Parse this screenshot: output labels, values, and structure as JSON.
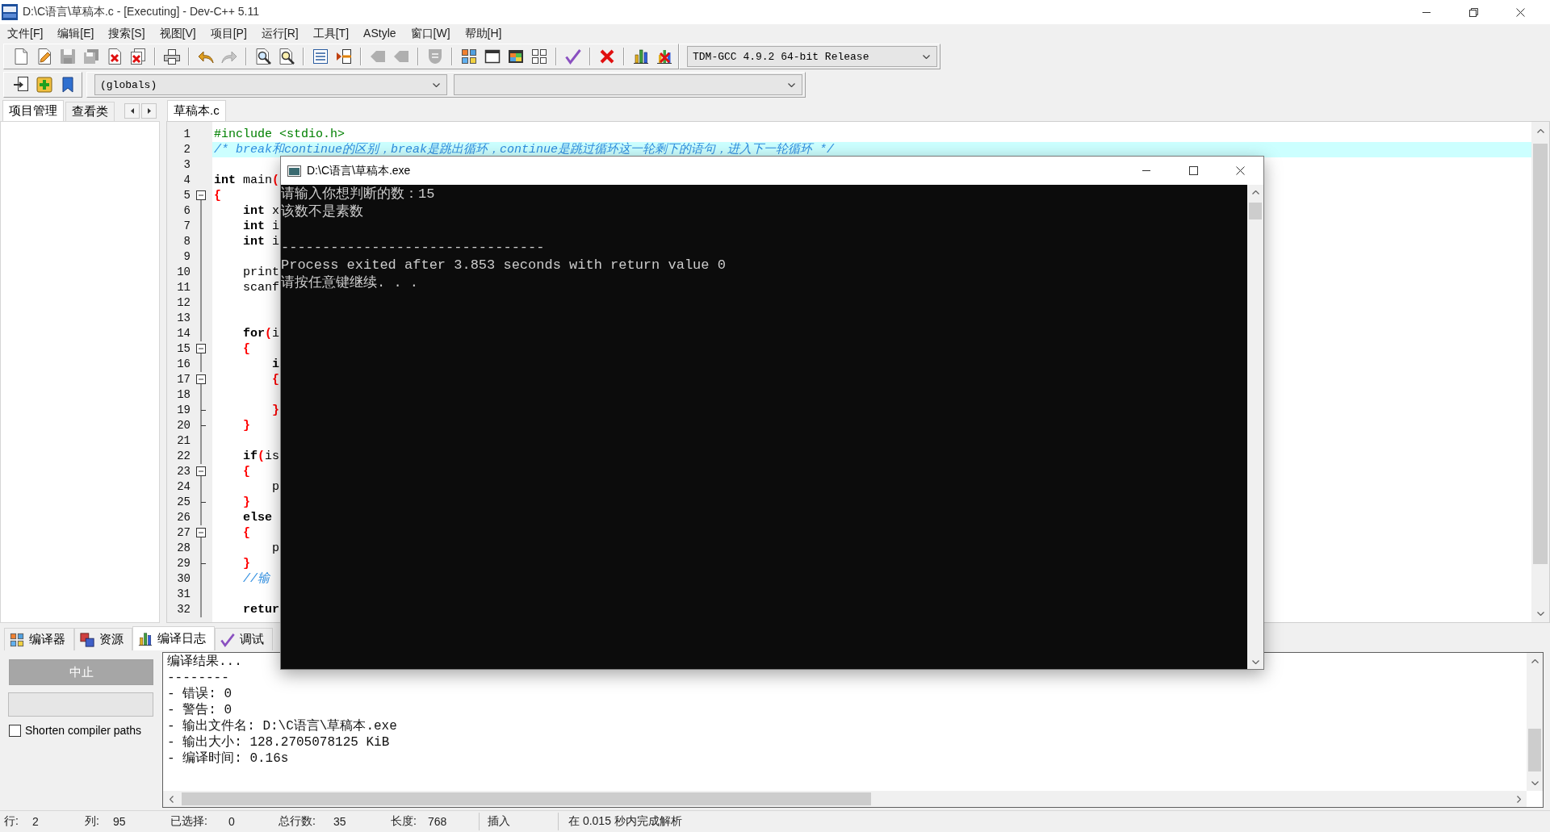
{
  "window": {
    "title": "D:\\C语言\\草稿本.c - [Executing] - Dev-C++ 5.11"
  },
  "menu": [
    "文件[F]",
    "编辑[E]",
    "搜索[S]",
    "视图[V]",
    "项目[P]",
    "运行[R]",
    "工具[T]",
    "AStyle",
    "窗口[W]",
    "帮助[H]"
  ],
  "main_toolbar": {
    "groups": [
      [
        {
          "kind": "new",
          "disabled": false
        },
        {
          "kind": "open",
          "disabled": false
        },
        {
          "kind": "save",
          "disabled": true
        },
        {
          "kind": "save_all",
          "disabled": true
        },
        {
          "kind": "close",
          "disabled": false
        },
        {
          "kind": "close_all",
          "disabled": false
        }
      ],
      [
        {
          "kind": "print",
          "disabled": false
        }
      ],
      [
        {
          "kind": "undo",
          "disabled": false
        },
        {
          "kind": "redo",
          "disabled": true
        }
      ],
      [
        {
          "kind": "find",
          "disabled": false
        },
        {
          "kind": "replace",
          "disabled": false
        }
      ],
      [
        {
          "kind": "goto",
          "disabled": false
        },
        {
          "kind": "indent",
          "disabled": false
        }
      ],
      [
        {
          "kind": "prev",
          "disabled": true
        },
        {
          "kind": "next",
          "disabled": true
        }
      ],
      [
        {
          "kind": "bookmark",
          "disabled": true
        }
      ],
      [
        {
          "kind": "compile",
          "disabled": false
        },
        {
          "kind": "run",
          "disabled": false
        },
        {
          "kind": "compile_run",
          "disabled": false
        },
        {
          "kind": "rebuild",
          "disabled": false
        }
      ],
      [
        {
          "kind": "check",
          "disabled": false
        }
      ],
      [
        {
          "kind": "abort",
          "disabled": false
        }
      ],
      [
        {
          "kind": "profile",
          "disabled": false
        },
        {
          "kind": "delete_profile",
          "disabled": false
        }
      ]
    ],
    "compiler": "TDM-GCC 4.9.2 64-bit Release"
  },
  "class_toolbar": {
    "buttons": [
      {
        "kind": "insert"
      },
      {
        "kind": "add"
      },
      {
        "kind": "mark"
      }
    ],
    "scope": "(globals)"
  },
  "side_panel": {
    "tabs": [
      {
        "label": "项目管理",
        "selected": true
      },
      {
        "label": "查看类",
        "selected": false
      }
    ]
  },
  "editor": {
    "tabs": [
      {
        "label": "草稿本.c",
        "selected": true
      }
    ],
    "lines": [
      {
        "number": "1",
        "kind": "plain",
        "highlighted": false,
        "tokens": [
          {
            "text": "#include <stdio.h>",
            "kind": "preprocessor"
          }
        ]
      },
      {
        "number": "2",
        "kind": "plain",
        "highlighted": true,
        "tokens": [
          {
            "text": "/* break和continue的区别，break是跳出循环，continue是跳过循环这一轮剩下的语句，进入下一轮循环 */",
            "kind": "comment"
          }
        ]
      },
      {
        "number": "3",
        "kind": "plain",
        "highlighted": false
      },
      {
        "number": "4",
        "kind": "plain",
        "highlighted": false,
        "tokens": [
          {
            "text": "int",
            "kind": "keyword"
          },
          {
            "text": " main",
            "kind": "plain"
          },
          {
            "text": "(",
            "kind": "symbol"
          }
        ]
      },
      {
        "number": "5",
        "kind": "opener",
        "highlighted": false,
        "tokens": [
          {
            "text": "{",
            "kind": "symbol"
          }
        ]
      },
      {
        "number": "6",
        "kind": "inner",
        "highlighted": false,
        "tokens": [
          {
            "text": "    int",
            "kind": "keyword"
          },
          {
            "text": " x",
            "kind": "plain"
          }
        ]
      },
      {
        "number": "7",
        "kind": "inner",
        "highlighted": false,
        "tokens": [
          {
            "text": "    int",
            "kind": "keyword"
          },
          {
            "text": " i",
            "kind": "plain"
          }
        ]
      },
      {
        "number": "8",
        "kind": "inner",
        "highlighted": false,
        "tokens": [
          {
            "text": "    int",
            "kind": "keyword"
          },
          {
            "text": " i",
            "kind": "plain"
          }
        ]
      },
      {
        "number": "9",
        "kind": "inner",
        "highlighted": false
      },
      {
        "number": "10",
        "kind": "inner",
        "highlighted": false,
        "tokens": [
          {
            "text": "    print",
            "kind": "plain"
          }
        ]
      },
      {
        "number": "11",
        "kind": "inner",
        "highlighted": false,
        "tokens": [
          {
            "text": "    scanf",
            "kind": "plain"
          }
        ]
      },
      {
        "number": "12",
        "kind": "inner",
        "highlighted": false
      },
      {
        "number": "13",
        "kind": "inner",
        "highlighted": false
      },
      {
        "number": "14",
        "kind": "inner",
        "highlighted": false,
        "tokens": [
          {
            "text": "    for",
            "kind": "keyword"
          },
          {
            "text": "(",
            "kind": "symbol"
          },
          {
            "text": "i",
            "kind": "plain"
          }
        ]
      },
      {
        "number": "15",
        "kind": "opener",
        "highlighted": false,
        "tokens": [
          {
            "text": "    {",
            "kind": "symbol"
          }
        ]
      },
      {
        "number": "16",
        "kind": "inner",
        "highlighted": false,
        "tokens": [
          {
            "text": "        i",
            "kind": "keyword"
          }
        ]
      },
      {
        "number": "17",
        "kind": "opener",
        "highlighted": false,
        "tokens": [
          {
            "text": "        {",
            "kind": "symbol"
          }
        ]
      },
      {
        "number": "18",
        "kind": "inner",
        "highlighted": false
      },
      {
        "number": "19",
        "kind": "closer",
        "highlighted": false,
        "tokens": [
          {
            "text": "        }",
            "kind": "symbol"
          }
        ]
      },
      {
        "number": "20",
        "kind": "closer",
        "highlighted": false,
        "tokens": [
          {
            "text": "    }",
            "kind": "symbol"
          }
        ]
      },
      {
        "number": "21",
        "kind": "inner",
        "highlighted": false
      },
      {
        "number": "22",
        "kind": "inner",
        "highlighted": false,
        "tokens": [
          {
            "text": "    if",
            "kind": "keyword"
          },
          {
            "text": "(",
            "kind": "symbol"
          },
          {
            "text": "is",
            "kind": "plain"
          }
        ]
      },
      {
        "number": "23",
        "kind": "opener",
        "highlighted": false,
        "tokens": [
          {
            "text": "    {",
            "kind": "symbol"
          }
        ]
      },
      {
        "number": "24",
        "kind": "inner",
        "highlighted": false,
        "tokens": [
          {
            "text": "        p",
            "kind": "plain"
          }
        ]
      },
      {
        "number": "25",
        "kind": "closer",
        "highlighted": false,
        "tokens": [
          {
            "text": "    }",
            "kind": "symbol"
          }
        ]
      },
      {
        "number": "26",
        "kind": "inner",
        "highlighted": false,
        "tokens": [
          {
            "text": "    else",
            "kind": "keyword"
          }
        ]
      },
      {
        "number": "27",
        "kind": "opener",
        "highlighted": false,
        "tokens": [
          {
            "text": "    {",
            "kind": "symbol"
          }
        ]
      },
      {
        "number": "28",
        "kind": "inner",
        "highlighted": false,
        "tokens": [
          {
            "text": "        p",
            "kind": "plain"
          }
        ]
      },
      {
        "number": "29",
        "kind": "closer",
        "highlighted": false,
        "tokens": [
          {
            "text": "    }",
            "kind": "symbol"
          }
        ]
      },
      {
        "number": "30",
        "kind": "inner",
        "highlighted": false,
        "tokens": [
          {
            "text": "    //输",
            "kind": "comment"
          }
        ]
      },
      {
        "number": "31",
        "kind": "inner",
        "highlighted": false
      },
      {
        "number": "32",
        "kind": "inner",
        "highlighted": false,
        "tokens": [
          {
            "text": "    retur",
            "kind": "keyword"
          }
        ]
      }
    ]
  },
  "console_window": {
    "title": "D:\\C语言\\草稿本.exe",
    "output": [
      [
        "请输入你想判断的数：15",
        "该数不是素数"
      ],
      [
        "--------------------------------",
        "Process exited after 3.853 seconds with return value 0",
        "请按任意键继续. . ."
      ]
    ]
  },
  "bottom_tabs": [
    {
      "label": "编译器",
      "kind": "compiler",
      "selected": false
    },
    {
      "label": "资源",
      "kind": "resources",
      "selected": false
    },
    {
      "label": "编译日志",
      "kind": "log",
      "selected": true
    },
    {
      "label": "调试",
      "kind": "debug",
      "selected": false
    }
  ],
  "build_panel": {
    "abort_button": {
      "label": "中止",
      "disabled": true
    },
    "progress": {
      "level": 0
    },
    "shorten_paths": {
      "label": "Shorten compiler paths",
      "checked": false
    },
    "log": [
      "编译结果...",
      "--------",
      "- 错误: 0",
      "- 警告: 0",
      "- 输出文件名: D:\\C语言\\草稿本.exe",
      "- 输出大小: 128.2705078125 KiB",
      "- 编译时间: 0.16s"
    ]
  },
  "status_bar": {
    "fields": [
      {
        "label": "行:",
        "value": "2"
      },
      {
        "label": "列:",
        "value": "95"
      },
      {
        "label": "已选择:",
        "value": "0"
      },
      {
        "label": "总行数:",
        "value": "35"
      },
      {
        "label": "长度:",
        "value": "768"
      }
    ],
    "mode": "插入",
    "message": "在 0.015 秒内完成解析"
  }
}
